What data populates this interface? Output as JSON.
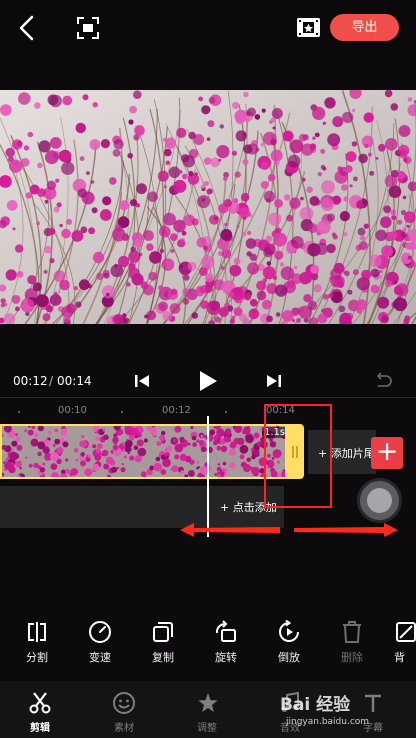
{
  "header": {
    "export_label": "导出"
  },
  "player": {
    "current_time": "00:12",
    "separator": "/",
    "total_time": "00:14"
  },
  "ruler": {
    "labels": [
      "00:10",
      "00:12",
      "00:14"
    ]
  },
  "timeline": {
    "clip_duration": "1.1s",
    "add_clip_label": "+ 添加片尾",
    "add_subtitle_label": "+ 点击添加"
  },
  "tools": [
    {
      "label": "分割",
      "icon": "split-icon",
      "enabled": true
    },
    {
      "label": "变速",
      "icon": "speed-icon",
      "enabled": true
    },
    {
      "label": "复制",
      "icon": "copy-icon",
      "enabled": true
    },
    {
      "label": "旋转",
      "icon": "rotate-icon",
      "enabled": true
    },
    {
      "label": "倒放",
      "icon": "reverse-icon",
      "enabled": true
    },
    {
      "label": "删除",
      "icon": "delete-icon",
      "enabled": false
    },
    {
      "label": "背",
      "icon": "background-icon",
      "enabled": true
    }
  ],
  "nav": [
    {
      "label": "剪辑",
      "icon": "scissors-icon",
      "active": true
    },
    {
      "label": "素材",
      "icon": "sticker-icon",
      "active": false
    },
    {
      "label": "调整",
      "icon": "star-icon",
      "active": false
    },
    {
      "label": "音效",
      "icon": "music-icon",
      "active": false
    },
    {
      "label": "字幕",
      "icon": "text-icon",
      "active": false
    }
  ],
  "watermark": {
    "logo": "Bai 经验",
    "url": "jingyan.baidu.com"
  },
  "colors": {
    "accent": "#f04e4a",
    "clip_border": "#ffe266",
    "annotation": "#ff2323"
  }
}
